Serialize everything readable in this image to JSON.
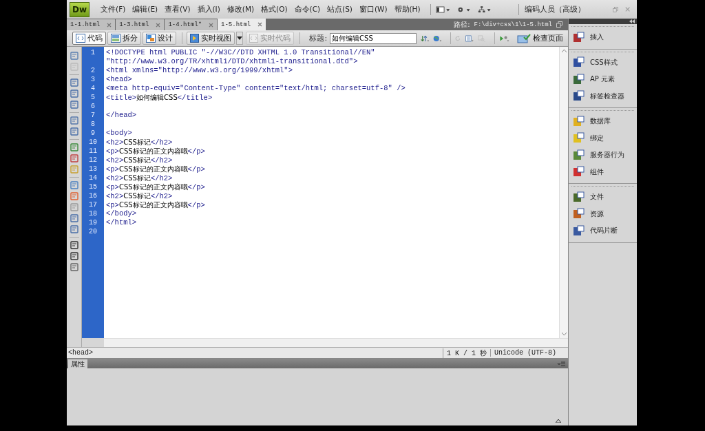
{
  "menu": {
    "logo": "Dw",
    "items": [
      "文件(F)",
      "编辑(E)",
      "查看(V)",
      "插入(I)",
      "修改(M)",
      "格式(O)",
      "命令(C)",
      "站点(S)",
      "窗口(W)",
      "帮助(H)"
    ],
    "workspace": "编码人员（高级）"
  },
  "tabs": [
    {
      "label": "1-1.html",
      "selected": false
    },
    {
      "label": "1-3.html",
      "selected": false
    },
    {
      "label": "1-4.html*",
      "selected": false
    },
    {
      "label": "1-5.html",
      "selected": true
    }
  ],
  "path": {
    "label": "路径:",
    "value": "F:\\div+css\\1\\1-5.html"
  },
  "toolbar": {
    "views": [
      {
        "label": "代码",
        "selected": true
      },
      {
        "label": "拆分",
        "selected": false
      },
      {
        "label": "设计",
        "selected": false
      }
    ],
    "live_view": {
      "label": "实时视图",
      "disabled": false
    },
    "live_code": {
      "label": "实时代码",
      "disabled": true
    },
    "title_label": "标题:",
    "title_value": "如何编辑CSS",
    "inspect": "检查页面"
  },
  "code": {
    "lines": [
      {
        "number": "1",
        "text": "<!DOCTYPE html PUBLIC \"-//W3C//DTD XHTML 1.0 Transitional//EN\"",
        "wrap": "\"http://www.w3.org/TR/xhtml1/DTD/xhtml1-transitional.dtd\">"
      },
      {
        "number": "2",
        "text": "<html xmlns=\"http://www.w3.org/1999/xhtml\">"
      },
      {
        "number": "3",
        "text": "<head>"
      },
      {
        "number": "4",
        "text": "<meta http-equiv=\"Content-Type\" content=\"text/html; charset=utf-8\" />"
      },
      {
        "number": "5",
        "text": "<title>如何编辑CSS</title>"
      },
      {
        "number": "6"
      },
      {
        "number": "7",
        "text": "</head>"
      },
      {
        "number": "8"
      },
      {
        "number": "9",
        "text": "<body>"
      },
      {
        "number": "10",
        "text": "<h2>CSS标记</h2>"
      },
      {
        "number": "11",
        "text": "<p>CSS标记的正文内容哦</p>"
      },
      {
        "number": "12",
        "text": "<h2>CSS标记</h2>"
      },
      {
        "number": "13",
        "text": "<p>CSS标记的正文内容哦</p>"
      },
      {
        "number": "14",
        "text": "<h2>CSS标记</h2>"
      },
      {
        "number": "15",
        "text": "<p>CSS标记的正文内容哦</p>"
      },
      {
        "number": "16",
        "text": "<h2>CSS标记</h2>"
      },
      {
        "number": "17",
        "text": "<p>CSS标记的正文内容哦</p>"
      },
      {
        "number": "18",
        "text": "</body>"
      },
      {
        "number": "19",
        "text": "</html>"
      },
      {
        "number": "20"
      }
    ]
  },
  "status": {
    "tag": "<head>",
    "size": "1 K / 1 秒",
    "encoding": "Unicode (UTF-8)"
  },
  "properties": {
    "title": "属性"
  },
  "panel": {
    "groups": [
      {
        "items": [
          {
            "label": "插入"
          }
        ]
      },
      {
        "items": [
          {
            "label": "CSS样式"
          },
          {
            "label": "AP 元素"
          },
          {
            "label": "标签检查器"
          }
        ]
      },
      {
        "items": [
          {
            "label": "数据库"
          },
          {
            "label": "绑定"
          },
          {
            "label": "服务器行为"
          },
          {
            "label": "组件"
          }
        ]
      },
      {
        "items": [
          {
            "label": "文件"
          },
          {
            "label": "资源"
          },
          {
            "label": "代码片断"
          }
        ]
      }
    ]
  }
}
